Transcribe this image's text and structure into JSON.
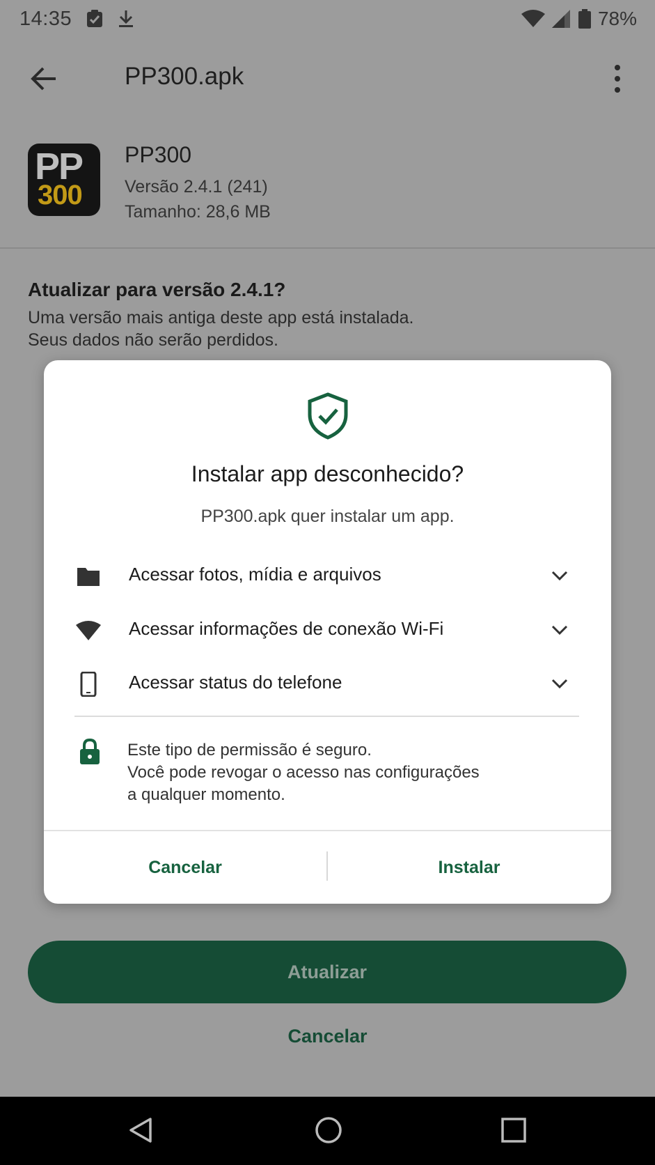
{
  "status_bar": {
    "time": "14:35",
    "battery": "78%",
    "icons": [
      "task-icon",
      "download-icon",
      "wifi-icon",
      "signal-icon",
      "battery-icon"
    ]
  },
  "app_bar": {
    "title": "PP300.apk"
  },
  "app_info": {
    "icon_text_top": "PP",
    "icon_text_bottom": "300",
    "name": "PP300",
    "version": "Versão 2.4.1 (241)",
    "size": "Tamanho: 28,6 MB"
  },
  "update_section": {
    "title": "Atualizar para versão 2.4.1?",
    "line1": "Uma versão mais antiga deste app está instalada.",
    "line2": "Seus dados não serão perdidos."
  },
  "dialog": {
    "title": "Instalar app desconhecido?",
    "subtitle": "PP300.apk quer instalar um app.",
    "permissions": [
      {
        "label": "Acessar fotos, mídia e arquivos",
        "icon": "folder-icon"
      },
      {
        "label": "Acessar informações de conexão Wi-Fi",
        "icon": "wifi-icon"
      },
      {
        "label": "Acessar status do telefone",
        "icon": "phone-icon"
      }
    ],
    "safe_line1": "Este tipo de permissão é seguro.",
    "safe_line2": "Você pode revogar o acesso nas configurações",
    "safe_line3": "a qualquer momento.",
    "cancel_label": "Cancelar",
    "install_label": "Instalar"
  },
  "bottom": {
    "update_label": "Atualizar",
    "cancel_label": "Cancelar"
  },
  "colors": {
    "accent": "#154c35",
    "accent_text": "#17623f"
  }
}
